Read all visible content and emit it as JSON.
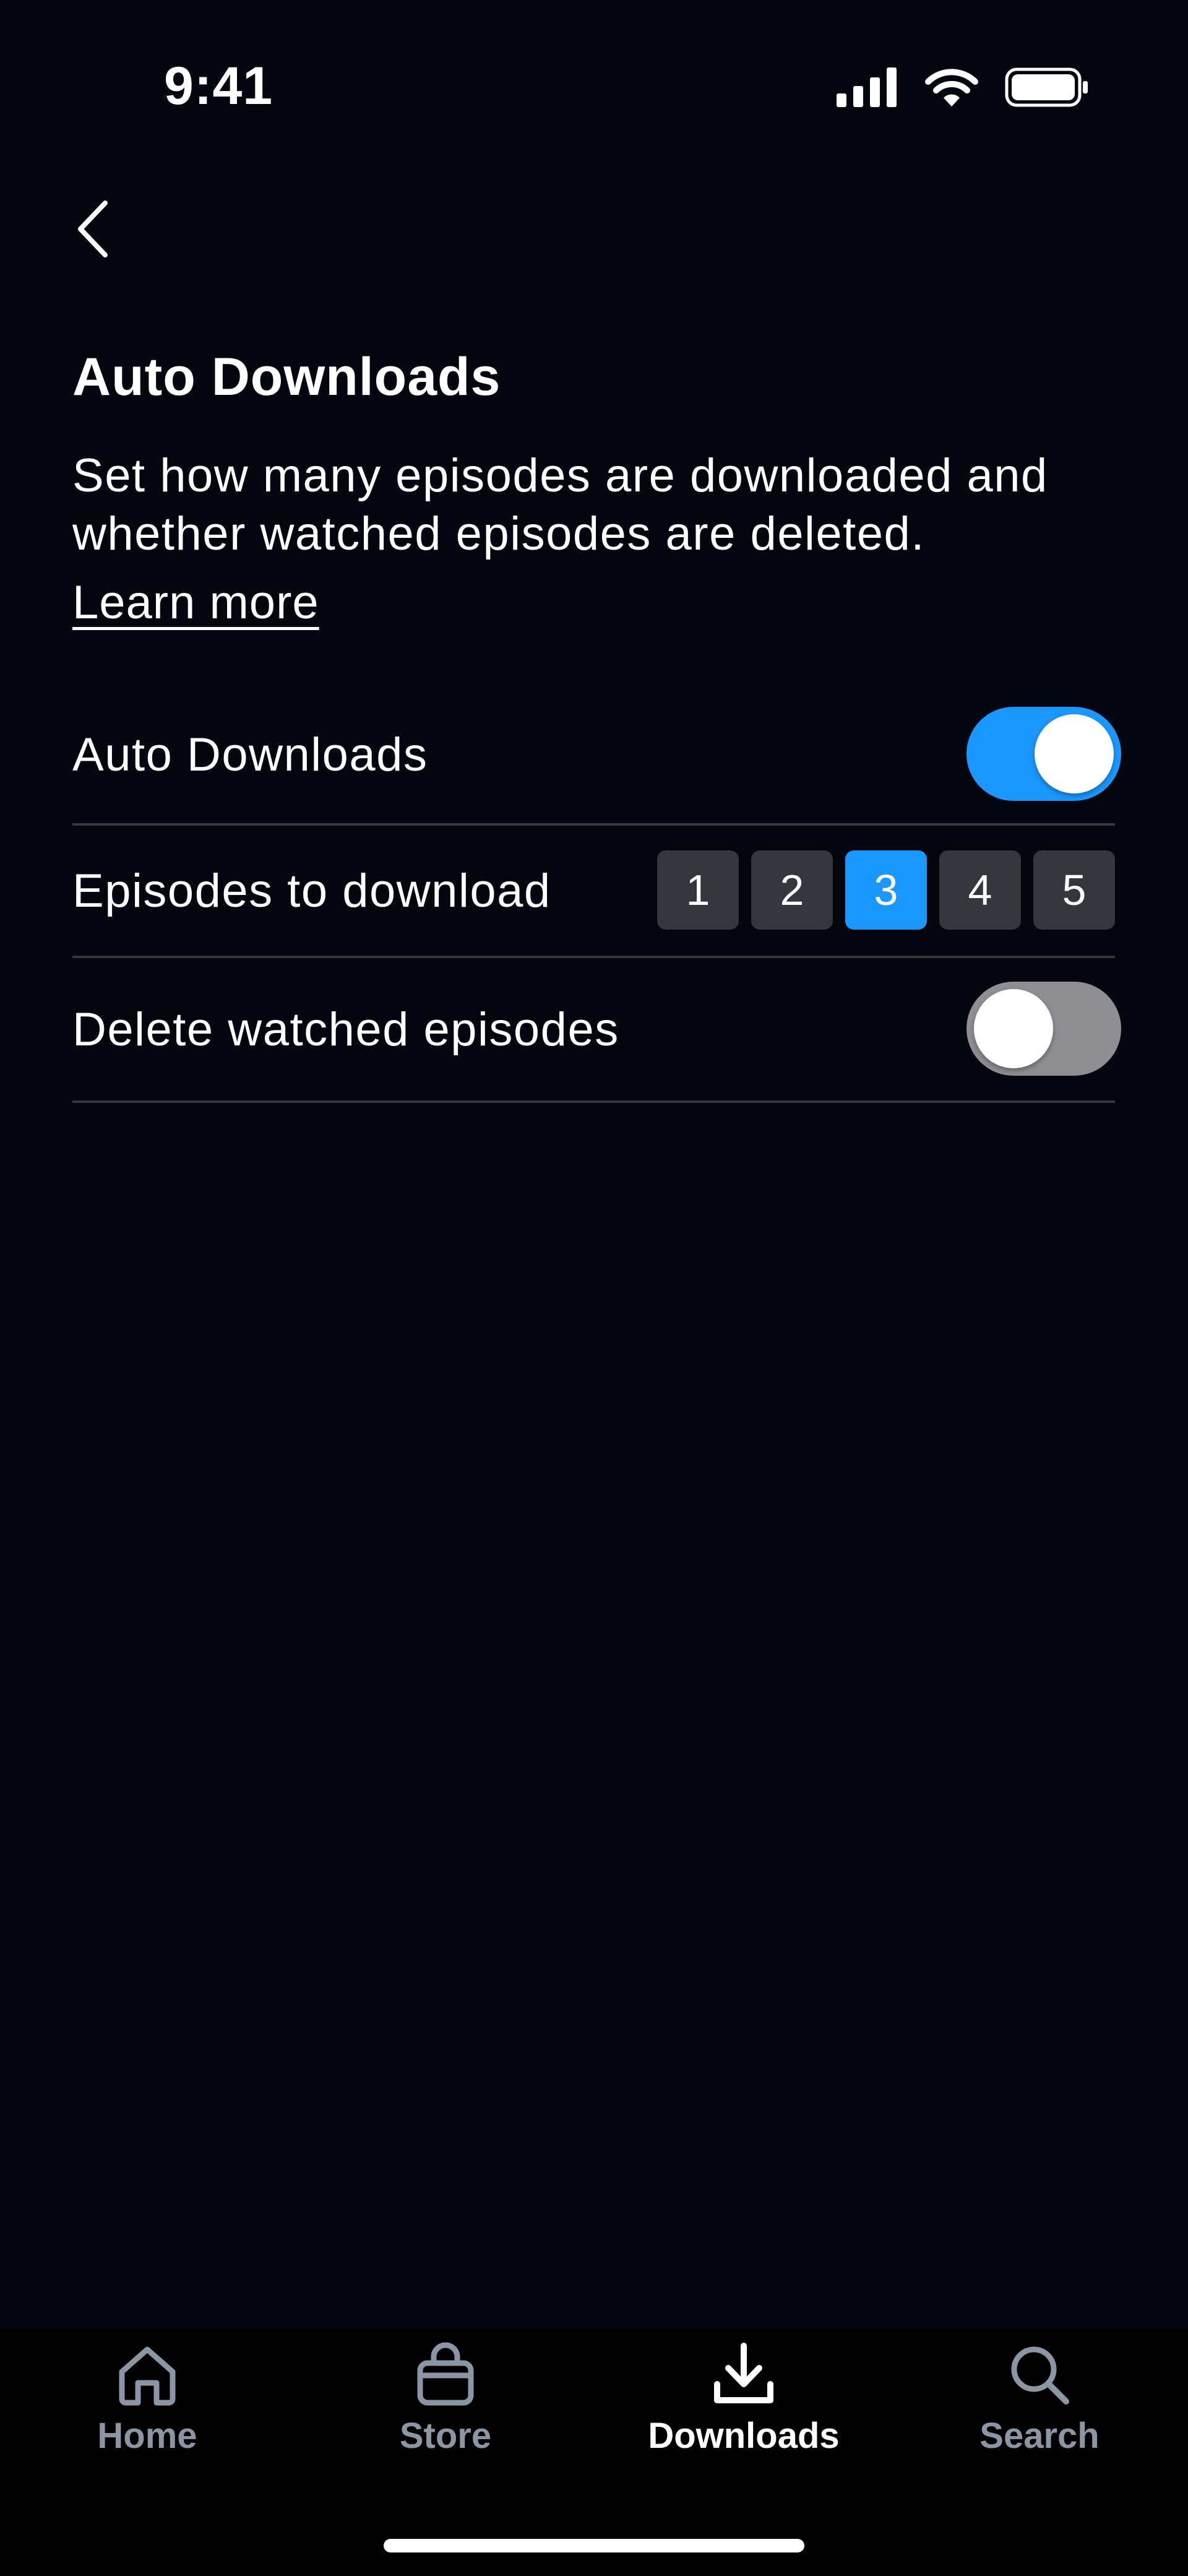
{
  "status_bar": {
    "time": "9:41"
  },
  "page": {
    "title": "Auto Downloads",
    "description": "Set how many episodes are downloaded and whether watched episodes are deleted.",
    "learn_more": "Learn more"
  },
  "settings": {
    "auto_downloads": {
      "label": "Auto Downloads",
      "enabled": true
    },
    "episodes": {
      "label": "Episodes to download",
      "options": [
        "1",
        "2",
        "3",
        "4",
        "5"
      ],
      "selected": "3"
    },
    "delete_watched": {
      "label": "Delete watched episodes",
      "enabled": false
    }
  },
  "tabs": [
    {
      "label": "Home",
      "icon": "home-icon"
    },
    {
      "label": "Store",
      "icon": "bag-icon"
    },
    {
      "label": "Downloads",
      "icon": "download-icon",
      "active": true
    },
    {
      "label": "Search",
      "icon": "search-icon"
    }
  ],
  "colors": {
    "accent": "#1a98ff",
    "background": "#03060f",
    "inactive": "#8a96a3",
    "button_bg": "#33363d"
  }
}
